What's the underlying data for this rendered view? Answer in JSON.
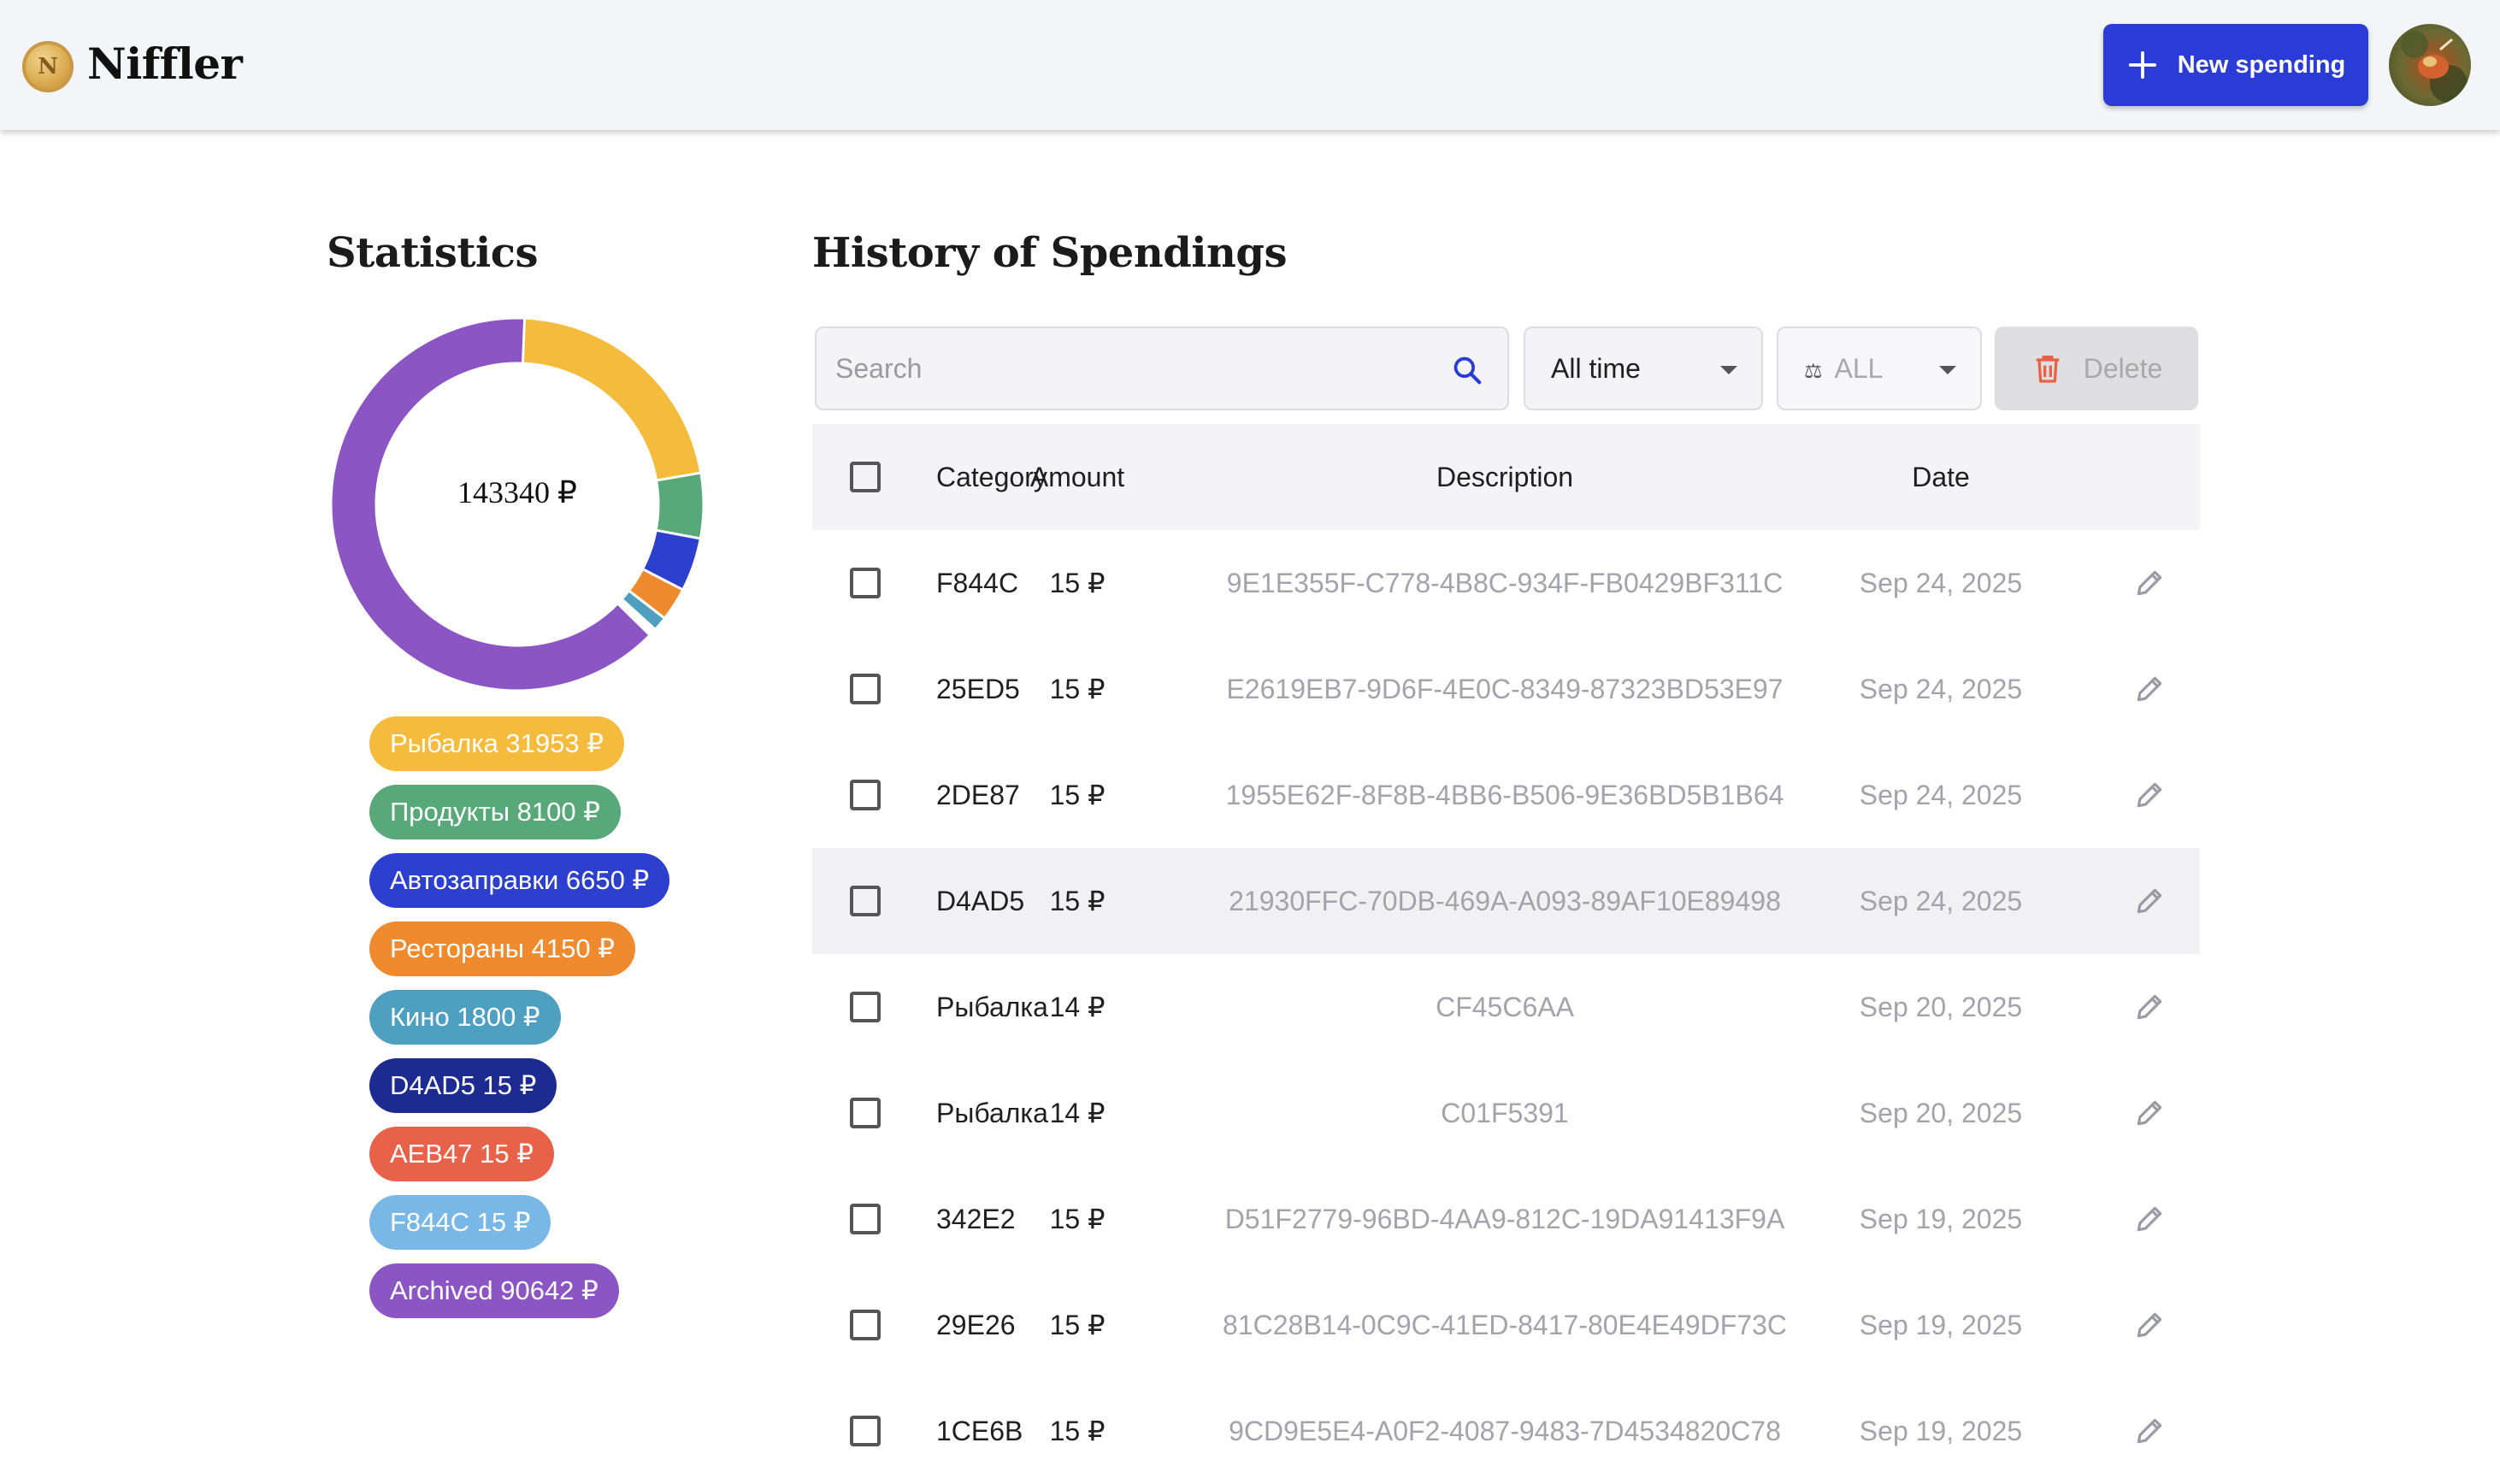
{
  "app": {
    "name": "Niffler",
    "logo_letter": "N"
  },
  "header": {
    "new_spending_label": "New spending"
  },
  "statistics": {
    "title": "Statistics",
    "total": "143340 ₽",
    "categories": [
      {
        "label": "Рыбалка 31953 ₽",
        "amount": 31953,
        "color": "#f4bb3c"
      },
      {
        "label": "Продукты 8100 ₽",
        "amount": 8100,
        "color": "#58a879"
      },
      {
        "label": "Автозаправки 6650 ₽",
        "amount": 6650,
        "color": "#2c3fcf"
      },
      {
        "label": "Рестораны 4150 ₽",
        "amount": 4150,
        "color": "#ef8a2f"
      },
      {
        "label": "Кино 1800 ₽",
        "amount": 1800,
        "color": "#4f9fc0"
      },
      {
        "label": "D4AD5 15 ₽",
        "amount": 15,
        "color": "#1d2a8f"
      },
      {
        "label": "AEB47 15 ₽",
        "amount": 15,
        "color": "#e8624a"
      },
      {
        "label": "F844C 15 ₽",
        "amount": 15,
        "color": "#79b7e6"
      },
      {
        "label": "Archived 90642 ₽",
        "amount": 90642,
        "color": "#8c55c4"
      }
    ]
  },
  "history": {
    "title": "History of Spendings",
    "search_placeholder": "Search",
    "period_filter": "All time",
    "currency_filter_icon": "⚖",
    "currency_filter": "ALL",
    "delete_label": "Delete",
    "columns": {
      "category": "Category",
      "amount": "Amount",
      "description": "Description",
      "date": "Date"
    },
    "rows": [
      {
        "category": "F844C",
        "amount": "15 ₽",
        "description": "9E1E355F-C778-4B8C-934F-FB0429BF311C",
        "date": "Sep 24, 2025"
      },
      {
        "category": "25ED5",
        "amount": "15 ₽",
        "description": "E2619EB7-9D6F-4E0C-8349-87323BD53E97",
        "date": "Sep 24, 2025"
      },
      {
        "category": "2DE87",
        "amount": "15 ₽",
        "description": "1955E62F-8F8B-4BB6-B506-9E36BD5B1B64",
        "date": "Sep 24, 2025"
      },
      {
        "category": "D4AD5",
        "amount": "15 ₽",
        "description": "21930FFC-70DB-469A-A093-89AF10E89498",
        "date": "Sep 24, 2025"
      },
      {
        "category": "Рыбалка",
        "amount": "14 ₽",
        "description": "CF45C6AA",
        "date": "Sep 20, 2025"
      },
      {
        "category": "Рыбалка",
        "amount": "14 ₽",
        "description": "C01F5391",
        "date": "Sep 20, 2025"
      },
      {
        "category": "342E2",
        "amount": "15 ₽",
        "description": "D51F2779-96BD-4AA9-812C-19DA91413F9A",
        "date": "Sep 19, 2025"
      },
      {
        "category": "29E26",
        "amount": "15 ₽",
        "description": "81C28B14-0C9C-41ED-8417-80E4E49DF73C",
        "date": "Sep 19, 2025"
      },
      {
        "category": "1CE6B",
        "amount": "15 ₽",
        "description": "9CD9E5E4-A0F2-4087-9483-7D4534820C78",
        "date": "Sep 19, 2025"
      }
    ]
  }
}
